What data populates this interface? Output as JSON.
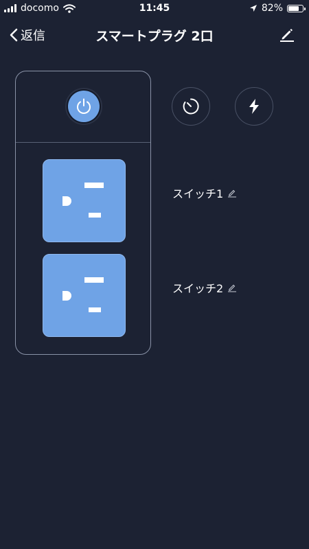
{
  "status_bar": {
    "carrier": "docomo",
    "time": "11:45",
    "battery_percent": "82%",
    "battery_level": 0.82,
    "icons": [
      "signal-bars-icon",
      "wifi-icon",
      "location-arrow-icon",
      "battery-icon"
    ]
  },
  "nav": {
    "back_label": "返信",
    "title": "スマートプラグ 2口",
    "edit_icon": "pencil-icon"
  },
  "device": {
    "power_icon": "power-icon",
    "power_color": "#6fa3e6",
    "actions": [
      {
        "name": "timer",
        "icon": "timer-icon"
      },
      {
        "name": "power-usage",
        "icon": "lightning-icon"
      }
    ],
    "switches": [
      {
        "label": "スイッチ1",
        "icon": "pencil-icon"
      },
      {
        "label": "スイッチ2",
        "icon": "pencil-icon"
      }
    ]
  },
  "colors": {
    "background": "#1c2233",
    "accent": "#6fa3e6",
    "panel_border": "#8a93a8"
  }
}
